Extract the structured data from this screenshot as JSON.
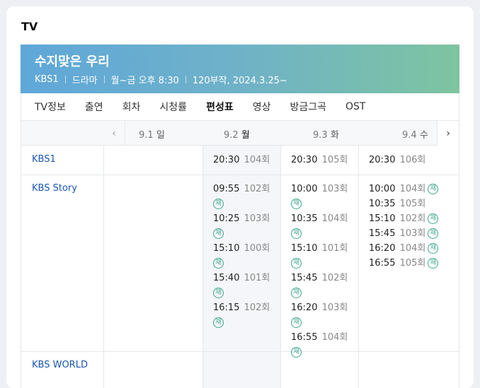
{
  "section_title": "TV",
  "program": {
    "title": "수지맞은 우리",
    "channel": "KBS1",
    "genre": "드라마",
    "airtime": "월~금 오후 8:30",
    "episodes_info": "120부작, 2024.3.25~"
  },
  "tabs": [
    "TV정보",
    "출연",
    "회차",
    "시청률",
    "편성표",
    "영상",
    "방금그곡",
    "OST"
  ],
  "active_tab": "편성표",
  "nav": {
    "prev_icon": "‹",
    "next_icon": "›"
  },
  "days": [
    {
      "date": "9.1",
      "weekday": "일"
    },
    {
      "date": "9.2",
      "weekday": "월"
    },
    {
      "date": "9.3",
      "weekday": "화"
    },
    {
      "date": "9.4",
      "weekday": "수"
    }
  ],
  "rebroadcast_mark": "재",
  "channels": [
    {
      "name": "KBS1",
      "slots": [
        [],
        [
          {
            "time": "20:30",
            "ep": "104회",
            "re": false
          }
        ],
        [
          {
            "time": "20:30",
            "ep": "105회",
            "re": false
          }
        ],
        [
          {
            "time": "20:30",
            "ep": "106회",
            "re": false
          }
        ]
      ]
    },
    {
      "name": "KBS Story",
      "slots": [
        [],
        [
          {
            "time": "09:55",
            "ep": "102회",
            "re": true
          },
          {
            "time": "10:25",
            "ep": "103회",
            "re": true
          },
          {
            "time": "15:10",
            "ep": "100회",
            "re": true
          },
          {
            "time": "15:40",
            "ep": "101회",
            "re": true
          },
          {
            "time": "16:15",
            "ep": "102회",
            "re": true
          }
        ],
        [
          {
            "time": "10:00",
            "ep": "103회",
            "re": true
          },
          {
            "time": "10:35",
            "ep": "104회",
            "re": true
          },
          {
            "time": "15:10",
            "ep": "101회",
            "re": true
          },
          {
            "time": "15:45",
            "ep": "102회",
            "re": true
          },
          {
            "time": "16:20",
            "ep": "103회",
            "re": true
          },
          {
            "time": "16:55",
            "ep": "104회",
            "re": true
          }
        ],
        [
          {
            "time": "10:00",
            "ep": "104회",
            "re": true
          },
          {
            "time": "10:35",
            "ep": "105회",
            "re": false
          },
          {
            "time": "15:10",
            "ep": "102회",
            "re": true
          },
          {
            "time": "15:45",
            "ep": "103회",
            "re": true
          },
          {
            "time": "16:20",
            "ep": "104회",
            "re": true
          },
          {
            "time": "16:55",
            "ep": "105회",
            "re": true
          }
        ]
      ]
    },
    {
      "name": "KBS WORLD",
      "slots": [
        [],
        [],
        [],
        []
      ]
    }
  ]
}
